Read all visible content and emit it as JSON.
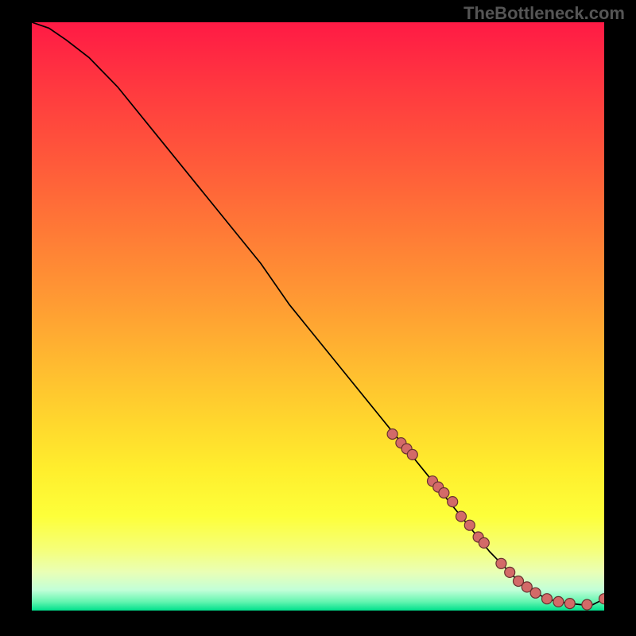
{
  "watermark": "TheBottleneck.com",
  "gradient_stops": [
    {
      "offset": 0.0,
      "color": "#ff1a45"
    },
    {
      "offset": 0.12,
      "color": "#ff3b3f"
    },
    {
      "offset": 0.24,
      "color": "#ff5a3a"
    },
    {
      "offset": 0.36,
      "color": "#ff7b36"
    },
    {
      "offset": 0.48,
      "color": "#ff9c33"
    },
    {
      "offset": 0.58,
      "color": "#ffba30"
    },
    {
      "offset": 0.68,
      "color": "#ffd72d"
    },
    {
      "offset": 0.76,
      "color": "#ffee2d"
    },
    {
      "offset": 0.84,
      "color": "#fdff3a"
    },
    {
      "offset": 0.895,
      "color": "#f6ff77"
    },
    {
      "offset": 0.935,
      "color": "#e9ffb6"
    },
    {
      "offset": 0.965,
      "color": "#c2ffd8"
    },
    {
      "offset": 0.985,
      "color": "#64f5b0"
    },
    {
      "offset": 1.0,
      "color": "#00e08c"
    }
  ],
  "chart_data": {
    "type": "line",
    "title": "",
    "xlabel": "",
    "ylabel": "",
    "xlim": [
      0,
      100
    ],
    "ylim": [
      0,
      100
    ],
    "series": [
      {
        "name": "curve",
        "x": [
          0,
          3,
          6,
          10,
          15,
          20,
          25,
          30,
          35,
          40,
          45,
          50,
          55,
          60,
          65,
          70,
          75,
          80,
          82,
          84,
          86,
          88,
          90,
          92,
          94,
          96,
          98,
          100
        ],
        "y": [
          100,
          99,
          97,
          94,
          89,
          83,
          77,
          71,
          65,
          59,
          52,
          46,
          40,
          34,
          28,
          22,
          16,
          10,
          8,
          6,
          4,
          3,
          2,
          1.5,
          1.2,
          1,
          1,
          2
        ]
      },
      {
        "name": "markers",
        "x": [
          63,
          64.5,
          65.5,
          66.5,
          70,
          71,
          72,
          73.5,
          75,
          76.5,
          78,
          79,
          82,
          83.5,
          85,
          86.5,
          88,
          90,
          92,
          94,
          97,
          100
        ],
        "y": [
          30,
          28.5,
          27.5,
          26.5,
          22,
          21,
          20,
          18.5,
          16,
          14.5,
          12.5,
          11.5,
          8,
          6.5,
          5,
          4,
          3,
          2,
          1.5,
          1.2,
          1,
          2
        ]
      }
    ]
  }
}
